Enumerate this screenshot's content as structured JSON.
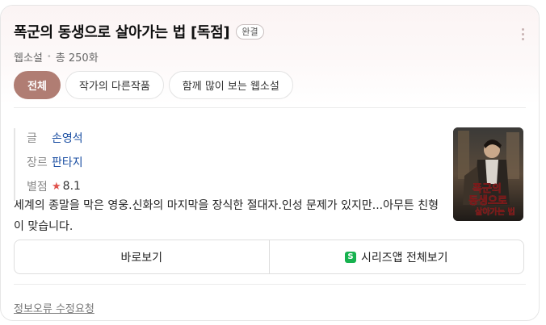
{
  "header": {
    "title": "폭군의 동생으로 살아가는 법 [독점]",
    "badge": "완결",
    "category": "웹소설",
    "episodes": "총 250화"
  },
  "tabs": [
    {
      "label": "전체",
      "active": true
    },
    {
      "label": "작가의 다른작품",
      "active": false
    },
    {
      "label": "함께 많이 보는 웹소설",
      "active": false
    }
  ],
  "info": {
    "author_label": "글",
    "author": "손영석",
    "genre_label": "장르",
    "genre": "판타지",
    "rating_label": "별점",
    "rating": "8.1"
  },
  "cover": {
    "text_line1": "폭군의",
    "text_line2": "동생으로",
    "text_line3": "살아가는 법"
  },
  "description": "세계의 종말을 막은 영웅.신화의 마지막을 장식한 절대자.인성 문제가 있지만...아무튼 친형이 맞습니다.",
  "actions": {
    "read_label": "바로보기",
    "series_label": "시리즈앱 전체보기",
    "series_icon_letter": "S"
  },
  "footer": {
    "report_label": "정보오류 수정요청"
  },
  "colors": {
    "accent": "#b07d73",
    "link": "#1a4ea2",
    "star": "#e0524c",
    "series_app": "#17b24f"
  }
}
